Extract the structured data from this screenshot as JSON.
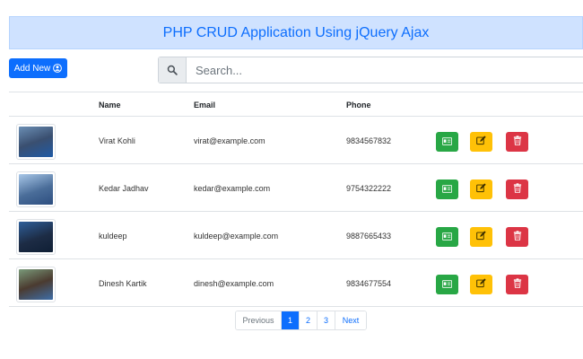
{
  "header": {
    "title": "PHP CRUD Application Using jQuery Ajax"
  },
  "toolbar": {
    "add_label": "Add New"
  },
  "search": {
    "placeholder": "Search..."
  },
  "table": {
    "columns": [
      "",
      "Name",
      "Email",
      "Phone",
      ""
    ],
    "rows": [
      {
        "name": "Virat Kohli",
        "email": "virat@example.com",
        "phone": "9834567832"
      },
      {
        "name": "Kedar Jadhav",
        "email": "kedar@example.com",
        "phone": "9754322222"
      },
      {
        "name": "kuldeep",
        "email": "kuldeep@example.com",
        "phone": "9887665433"
      },
      {
        "name": "Dinesh Kartik",
        "email": "dinesh@example.com",
        "phone": "9834677554"
      }
    ]
  },
  "pagination": {
    "previous": "Previous",
    "pages": [
      "1",
      "2",
      "3"
    ],
    "next": "Next",
    "current": "1"
  },
  "colors": {
    "primary": "#0d6efd",
    "success": "#28a745",
    "warning": "#ffc107",
    "danger": "#dc3545",
    "banner_bg": "#cfe2ff"
  },
  "icons": {
    "add": "user-circle-icon",
    "search": "search-icon",
    "view": "id-card-icon",
    "edit": "edit-icon",
    "delete": "trash-icon"
  }
}
